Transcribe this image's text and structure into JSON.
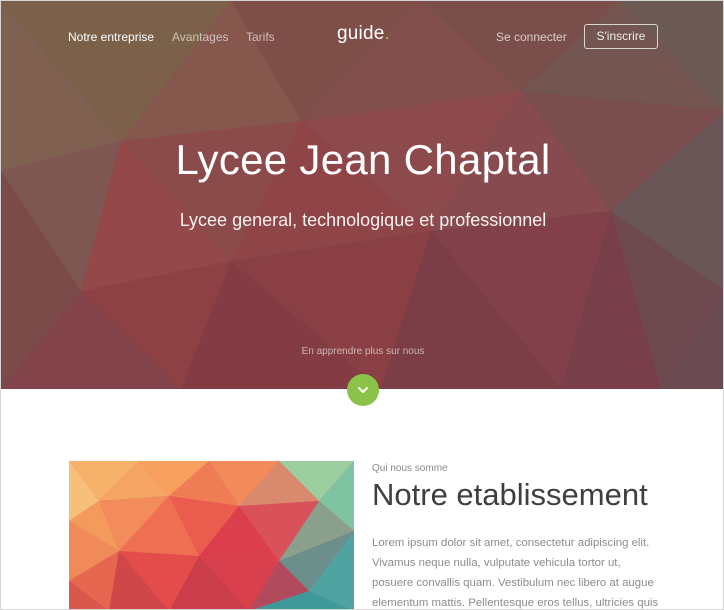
{
  "nav": {
    "links": [
      "Notre entreprise",
      "Avantages",
      "Tarifs"
    ],
    "logo": "guide",
    "logo_dot": ".",
    "login_label": "Se connecter",
    "signup_label": "S'inscrire"
  },
  "hero": {
    "title": "Lycee Jean Chaptal",
    "subtitle": "Lycee general, technologique et professionnel",
    "learn_more": "En apprendre plus sur nous"
  },
  "about": {
    "eyebrow": "Qui nous somme",
    "title": "Notre etablissement",
    "body": "Lorem ipsum dolor sit amet, consectetur adipiscing elit. Vivamus neque nulla, vulputate vehicula tortor ut, posuere convallis quam. Vestibulum nec libero at augue elementum mattis. Pellentesque eros tellus, ultricies quis"
  },
  "colors": {
    "accent": "#8bc34a",
    "hero_base": "#7a4a48"
  },
  "icons": {
    "scroll_down": "chevron-down-icon"
  }
}
